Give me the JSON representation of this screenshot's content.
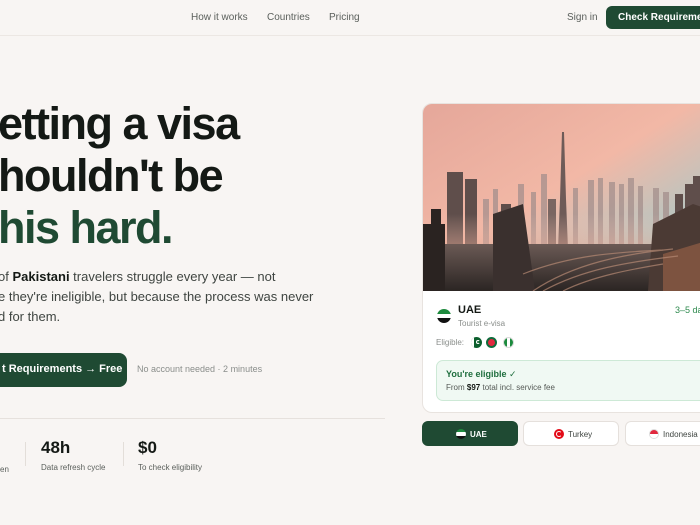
{
  "nav": {
    "links": [
      "How it works",
      "Countries",
      "Pricing"
    ],
    "signin": "Sign in",
    "cta": "Check Requirements"
  },
  "hero": {
    "title_line1": "etting a visa",
    "title_line2": "houldn't be",
    "title_line3": "his hard.",
    "sub_pre": "of ",
    "sub_bold": "Pakistani",
    "sub_post1": " travelers struggle every year — not",
    "sub_line2": "e they're ineligible, but because the process was never",
    "sub_line3": "d for them.",
    "cta": "t Requirements  →  Free",
    "note": "No account needed · 2 minutes"
  },
  "stats": [
    {
      "value": "",
      "label": "en"
    },
    {
      "value": "48h",
      "label": "Data refresh cycle"
    },
    {
      "value": "$0",
      "label": "To check eligibility"
    }
  ],
  "card": {
    "country": "UAE",
    "visa_type": "Tourist e-visa",
    "days": "3–5 da",
    "eligible_label": "Eligible:",
    "eligible_title": "You're eligible ✓",
    "price_pre": "From ",
    "price": "$97",
    "price_post": " total incl. service fee"
  },
  "chips": [
    {
      "label": "UAE",
      "icon": "uae-flag-icon",
      "active": true
    },
    {
      "label": "Turkey",
      "icon": "turkey-flag-icon",
      "active": false
    },
    {
      "label": "Indonesia",
      "icon": "indonesia-flag-icon",
      "active": false
    }
  ],
  "colors": {
    "brand": "#1f4a33",
    "success": "#2e8a4e",
    "background": "#f8f5f3"
  }
}
